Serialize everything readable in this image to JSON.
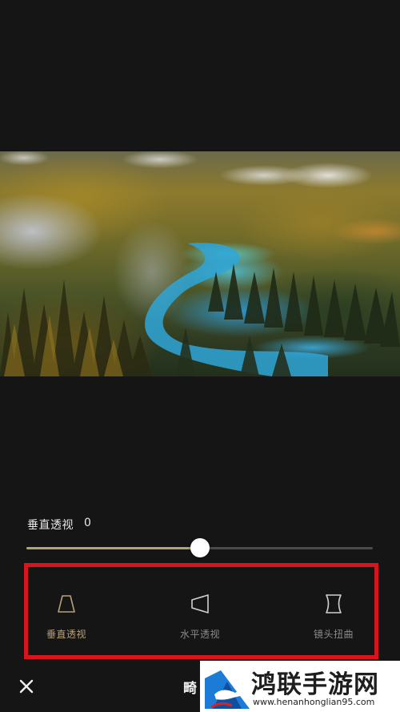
{
  "editor": {
    "parameter_label": "垂直透视",
    "parameter_value": "0",
    "slider_level": 0.5,
    "bottom_title": "畸"
  },
  "tools": [
    {
      "label": "垂直透视",
      "icon": "vertical-perspective-icon",
      "active": true
    },
    {
      "label": "水平透视",
      "icon": "horizontal-perspective-icon",
      "active": false
    },
    {
      "label": "镜头扭曲",
      "icon": "lens-distortion-icon",
      "active": false
    }
  ],
  "watermark": {
    "title": "鸿联手游网",
    "url": "www.henanhonglian95.com"
  },
  "colors": {
    "background": "#151515",
    "accent": "#b8a07a",
    "highlight_box": "#d8141c"
  }
}
